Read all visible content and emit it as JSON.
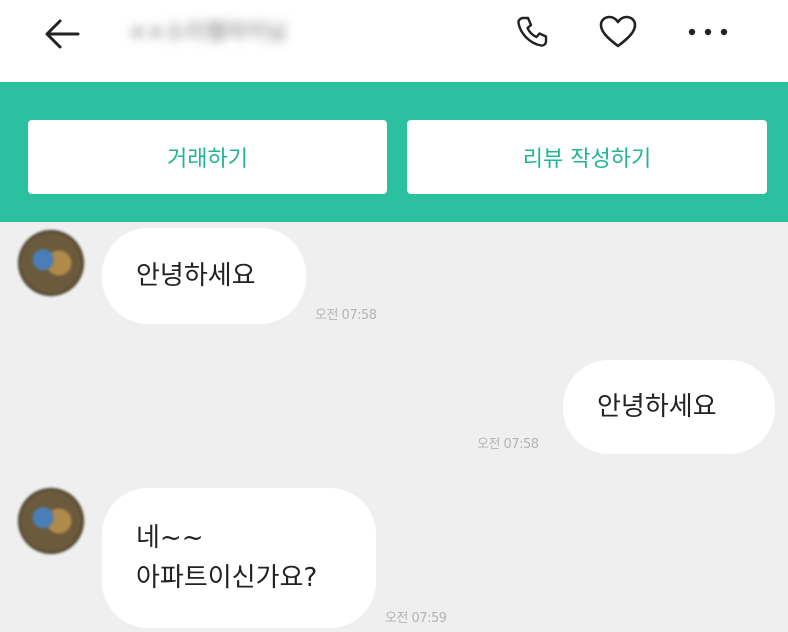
{
  "header": {
    "title": "××소리웹마이님"
  },
  "actions": {
    "trade_label": "거래하기",
    "review_label": "리뷰 작성하기"
  },
  "colors": {
    "accent": "#2bc0a0",
    "accent_text": "#20b596",
    "chat_background": "#efefef"
  },
  "messages": [
    {
      "direction": "incoming",
      "lines": [
        "안녕하세요"
      ],
      "time": "오전 07:58"
    },
    {
      "direction": "outgoing",
      "lines": [
        "안녕하세요"
      ],
      "time": "오전 07:58"
    },
    {
      "direction": "incoming",
      "lines": [
        "네~~",
        "아파트이신가요?"
      ],
      "time": "오전 07:59"
    }
  ]
}
